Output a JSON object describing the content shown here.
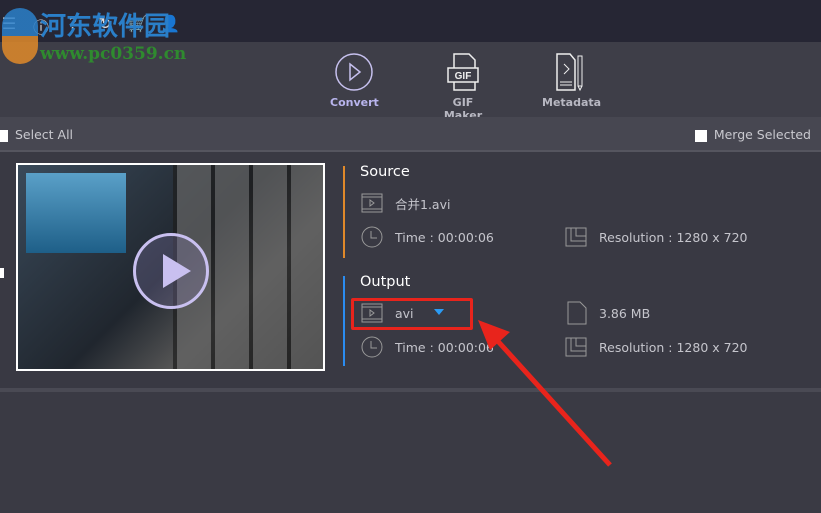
{
  "watermark": {
    "cn": "河东软件园",
    "url": "www.pc0359.cn"
  },
  "toolbar": {
    "convert": "Convert",
    "gif_maker": "GIF Maker",
    "gif_label": "GIF",
    "metadata": "Metadata"
  },
  "selection": {
    "select_all": "Select All",
    "merge_selected": "Merge Selected"
  },
  "source": {
    "heading": "Source",
    "filename": "合并1.avi",
    "time": "Time : 00:00:06",
    "resolution": "Resolution : 1280 x 720"
  },
  "output": {
    "heading": "Output",
    "format": "avi",
    "size": "3.86 MB",
    "time": "Time : 00:00:06",
    "resolution": "Resolution : 1280 x 720"
  },
  "colors": {
    "source_accent": "#e0892a",
    "output_accent": "#2b8cf0",
    "highlight": "#e8241c",
    "dropdown": "#2b9bf4"
  }
}
